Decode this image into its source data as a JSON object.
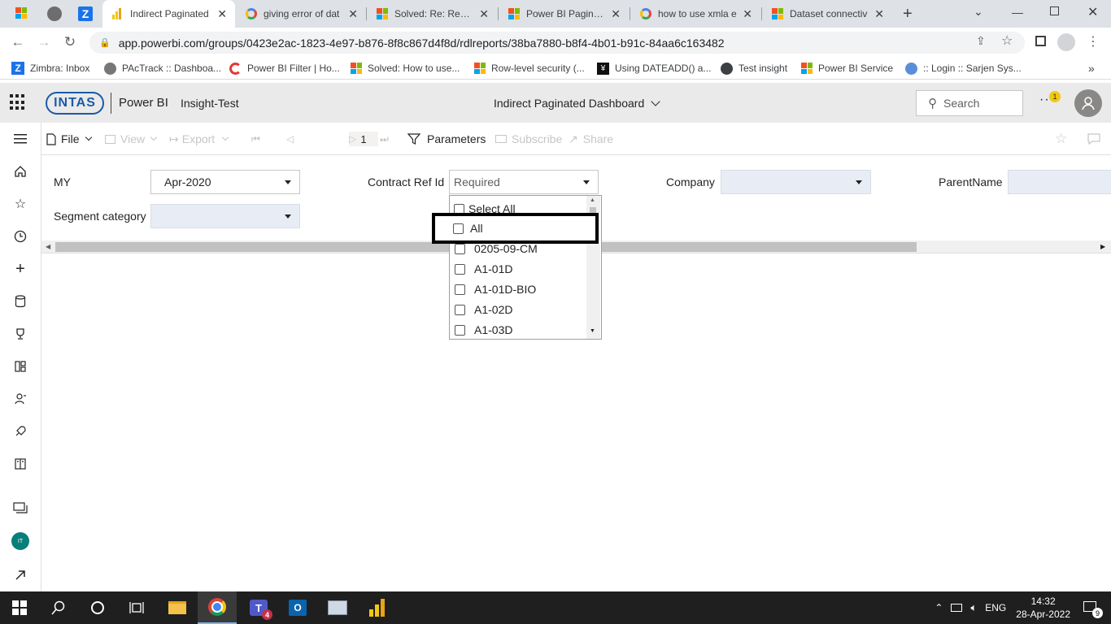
{
  "browser": {
    "tabs": [
      {
        "title": "Indirect Paginated",
        "active": true,
        "icon": "powerbi"
      },
      {
        "title": "giving error of dat",
        "active": false,
        "icon": "google"
      },
      {
        "title": "Solved: Re: Result",
        "active": false,
        "icon": "microsoft"
      },
      {
        "title": "Power BI Paginated",
        "active": false,
        "icon": "microsoft"
      },
      {
        "title": "how to use xmla e",
        "active": false,
        "icon": "google"
      },
      {
        "title": "Dataset connectiv",
        "active": false,
        "icon": "microsoft"
      }
    ],
    "url": "app.powerbi.com/groups/0423e2ac-1823-4e97-b876-8f8c867d4f8d/rdlreports/38ba7880-b8f4-4b01-b91c-84aa6c163482",
    "bookmarks": [
      {
        "label": "Zimbra: Inbox"
      },
      {
        "label": "PAcTrack :: Dashboa..."
      },
      {
        "label": "Power BI Filter | Ho..."
      },
      {
        "label": "Solved: How to use..."
      },
      {
        "label": "Row-level security (..."
      },
      {
        "label": "Using DATEADD() a..."
      },
      {
        "label": "Test insight"
      },
      {
        "label": "Power BI Service"
      },
      {
        "label": ":: Login :: Sarjen Sys..."
      }
    ]
  },
  "header": {
    "logo_text": "INTAS",
    "app_name": "Power BI",
    "workspace": "Insight-Test",
    "report_title": "Indirect Paginated Dashboard",
    "search_placeholder": "Search",
    "notification_count": "1"
  },
  "toolbar": {
    "file": "File",
    "view": "View",
    "export": "Export",
    "page_number": "1",
    "parameters": "Parameters",
    "subscribe": "Subscribe",
    "share": "Share"
  },
  "parameters": {
    "my_label": "MY",
    "my_value": "Apr-2020",
    "contract_label": "Contract Ref Id",
    "contract_placeholder": "Required",
    "company_label": "Company",
    "parent_label": "ParentName",
    "segment_label": "Segment category"
  },
  "contract_options": [
    {
      "label": "Select All"
    },
    {
      "label": "All"
    },
    {
      "label": "0205-09-CM"
    },
    {
      "label": "A1-01D"
    },
    {
      "label": "A1-01D-BIO"
    },
    {
      "label": "A1-02D"
    },
    {
      "label": "A1-03D"
    }
  ],
  "leftnav": {
    "icons": [
      "hamburger-icon",
      "home-icon",
      "star-icon",
      "clock-icon",
      "plus-icon",
      "database-icon",
      "trophy-icon",
      "apps-icon",
      "people-icon",
      "rocket-icon",
      "book-icon",
      "workspaces-icon",
      "workspace-avatar",
      "expand-icon"
    ],
    "workspace_initials": "IT"
  },
  "taskbar": {
    "language": "ENG",
    "time": "14:32",
    "date": "28-Apr-2022",
    "teams_badge": "4",
    "notification_count": "9"
  }
}
